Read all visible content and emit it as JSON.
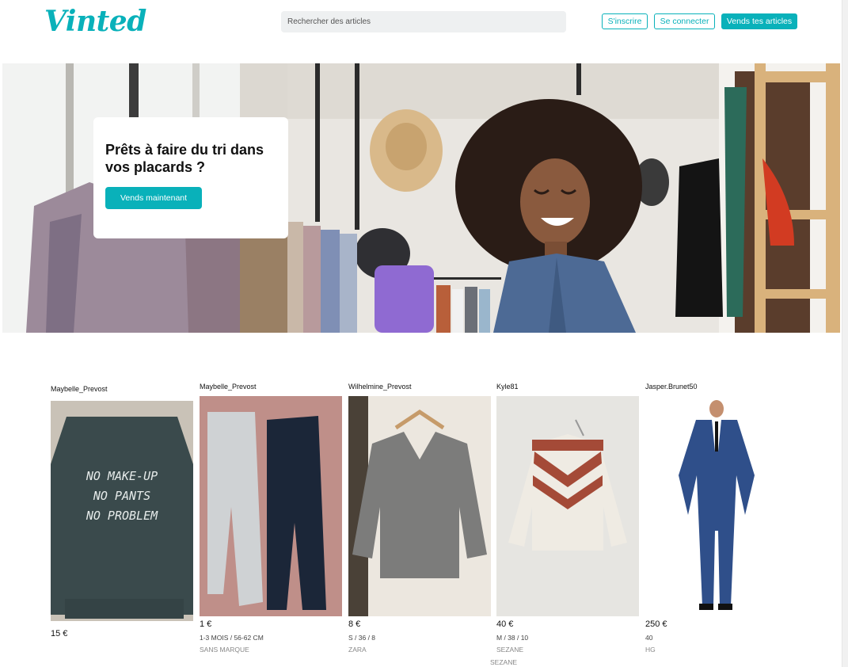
{
  "header": {
    "logo_text": "Vinted",
    "search_placeholder": "Rechercher des articles",
    "signup_label": "S'inscrire",
    "login_label": "Se connecter",
    "sell_label": "Vends tes articles"
  },
  "hero": {
    "title": "Prêts à faire du tri dans vos placards ?",
    "cta_label": "Vends maintenant"
  },
  "items": [
    {
      "seller": "Maybelle_Prevost",
      "price": "15 €",
      "size": "",
      "brand": "",
      "image": "sweatshirt-no-makeup-photo",
      "print_lines": [
        "NO MAKE-UP",
        "NO PANTS",
        "NO PROBLEM"
      ]
    },
    {
      "seller": "Maybelle_Prevost",
      "price": "1 €",
      "size": "1-3 MOIS / 56-62 CM",
      "brand": "SANS MARQUE",
      "image": "baby-tights-photo"
    },
    {
      "seller": "Wilhelmine_Prevost",
      "price": "8 €",
      "size": "S / 36 / 8",
      "brand": "ZARA",
      "image": "grey-knit-sweater-photo"
    },
    {
      "seller": "Kyle81",
      "price": "40 €",
      "size": "M / 38 / 10",
      "brand": "SEZANE",
      "image": "chevron-sweater-photo"
    },
    {
      "seller": "Jasper.Brunet50",
      "price": "250 €",
      "size": "40",
      "brand": "HG",
      "image": "blue-suit-photo"
    }
  ],
  "extra_brand_label": "SEZANE",
  "colors": {
    "accent": "#09b1ba",
    "search_bg": "#eef0f1"
  }
}
